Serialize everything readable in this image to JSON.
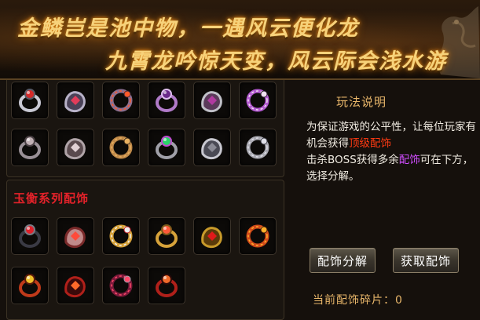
{
  "banner": {
    "line1": "金鳞岂是池中物，一遇风云便化龙",
    "line2": "九霄龙吟惊天变，风云际会浅水游"
  },
  "grid_top": {
    "items": [
      {
        "icon": "red-gem-ring-icon"
      },
      {
        "icon": "crown-ring-icon"
      },
      {
        "icon": "dragon-eye-ring-icon"
      },
      {
        "icon": "twisted-purple-ring-icon"
      },
      {
        "icon": "claw-ring-icon"
      },
      {
        "icon": "spiked-necklace-icon"
      },
      {
        "icon": "engraved-silver-ring-icon"
      },
      {
        "icon": "studded-silver-ring-icon"
      },
      {
        "icon": "spiked-orb-icon"
      },
      {
        "icon": "emerald-ring-icon"
      },
      {
        "icon": "silver-band-ring-icon"
      },
      {
        "icon": "skull-ring-icon"
      }
    ]
  },
  "grid_bottom": {
    "title": "玉衡系列配饰",
    "items": [
      {
        "icon": "ruby-dark-ring-icon"
      },
      {
        "icon": "blood-bracer-icon"
      },
      {
        "icon": "pearl-gold-ring-icon"
      },
      {
        "icon": "gold-jeweled-ring-icon"
      },
      {
        "icon": "gold-chain-necklace-icon"
      },
      {
        "icon": "flame-dark-ring-icon"
      },
      {
        "icon": "phoenix-bracelet-icon"
      },
      {
        "icon": "fire-ring-icon"
      },
      {
        "icon": "red-dark-bracer-icon"
      },
      {
        "icon": "dragon-pendant-icon"
      }
    ]
  },
  "rules": {
    "title": "玩法说明",
    "text_part1": "为保证游戏的公平性，让每位玩家有机会获得",
    "highlight1": "顶级配饰",
    "text_part2": "击杀BOSS获得多余",
    "highlight2": "配饰",
    "text_part3": "可在下方，选择分解。"
  },
  "buttons": {
    "decompose": "配饰分解",
    "obtain": "获取配饰"
  },
  "shards": {
    "label": "当前配饰碎片：0"
  },
  "colors": {
    "accent_gold": "#e8b66a",
    "highlight_orange": "#ff3a12",
    "highlight_purple": "#d04dff",
    "section_red": "#e4222a"
  }
}
